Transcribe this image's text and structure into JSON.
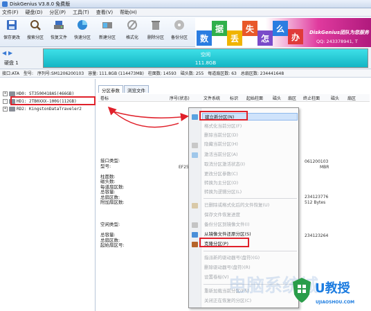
{
  "window": {
    "title": "DiskGenius V3.8.0 免费版"
  },
  "menubar": [
    "文件(F)",
    "硬盘(D)",
    "分区(P)",
    "工具(T)",
    "查看(V)",
    "帮助(H)"
  ],
  "toolbar": [
    {
      "label": "保存更改",
      "icon": "save-icon"
    },
    {
      "label": "搜索分区",
      "icon": "search-icon"
    },
    {
      "label": "恢复文件",
      "icon": "restore-icon"
    },
    {
      "label": "快速分区",
      "icon": "quick-partition-icon"
    },
    {
      "label": "新建分区",
      "icon": "new-partition-icon"
    },
    {
      "label": "格式化",
      "icon": "format-icon"
    },
    {
      "label": "删除分区",
      "icon": "delete-icon"
    },
    {
      "label": "备份分区",
      "icon": "backup-icon"
    }
  ],
  "banner": {
    "blocks": [
      "数",
      "据",
      "丢",
      "失",
      "怎",
      "么",
      "办"
    ],
    "brand": "DiskGenius团队为您服务",
    "qq": "QQ: 243378941, T"
  },
  "diskbar": {
    "disk_label": "硬盘 1",
    "partition_name": "空闲",
    "partition_size": "111.8GB"
  },
  "infobar": [
    "接口:ATA",
    "型号:",
    "序列号:SM1206200103",
    "容量: 111.8GB (114473MB)",
    "柱面数: 14593",
    "磁头数: 255",
    "每道扇区数: 63",
    "总扇区数: 234441648"
  ],
  "tree": [
    {
      "label": "HD0: ST3500418AS(466GB)",
      "expanded": "+"
    },
    {
      "label": "HD1: 2TB0XXX-100G(112GB)",
      "expanded": "-"
    },
    {
      "label": "RD2: KingstonDataTraveler2",
      "expanded": "+"
    }
  ],
  "tabs": [
    "分区参数",
    "浏览文件"
  ],
  "columns": [
    "卷标",
    "序号(状态)",
    "文件系统",
    "标识",
    "起始柱面",
    "磁头",
    "扇区",
    "终止柱面",
    "磁头",
    "扇区"
  ],
  "props_group1": [
    "接口类型:",
    "型号:",
    "",
    "柱面数:",
    "磁头数:",
    "每道扇区数:",
    "总容量:",
    "总扇区数:",
    "附加扇区数:"
  ],
  "props_group2": [
    "空闲类型:",
    "",
    "总容量:",
    "总扇区数:",
    "起始扇区号:"
  ],
  "prop_values": {
    "model": "EF250",
    "serial": "061200103",
    "mbr": "MBR",
    "sectors": "234123776",
    "bytes": "512 Bytes",
    "free_sectors": "234123264"
  },
  "context_menu": [
    {
      "label": "建立新分区(N)",
      "state": "highlighted"
    },
    {
      "label": "格式化当前分区(F)",
      "state": "disabled"
    },
    {
      "label": "删除当前分区(D)",
      "state": "disabled"
    },
    {
      "label": "隐藏当前分区(H)",
      "state": "disabled"
    },
    {
      "label": "激活当前分区(A)",
      "state": "disabled"
    },
    {
      "label": "取消分区激活状态(I)",
      "state": "disabled"
    },
    {
      "label": "更改分区参数(C)",
      "state": "disabled"
    },
    {
      "label": "转换为主分区(O)",
      "state": "disabled"
    },
    {
      "label": "转换为逻辑分区(L)",
      "state": "disabled"
    },
    {
      "label": "已删除或格式化后的文件恢复(U)",
      "state": "disabled"
    },
    {
      "label": "保存文件恢复进度",
      "state": "disabled"
    },
    {
      "label": "备份分区到镜像文件(I)",
      "state": "disabled"
    },
    {
      "label": "从镜像文件还原分区(S)",
      "state": "enabled"
    },
    {
      "label": "克隆分区(P)",
      "state": "enabled"
    },
    {
      "label": "指派新的驱动器号(盘符)(G)",
      "state": "disabled"
    },
    {
      "label": "删除驱动器号(盘符)(R)",
      "state": "disabled"
    },
    {
      "label": "设置卷标(V)",
      "state": "disabled"
    },
    {
      "label": "重新加载当前分区(F5)",
      "state": "disabled"
    },
    {
      "label": "关闭正在恢复的分区(C)",
      "state": "disabled"
    }
  ],
  "watermark": {
    "letter": "U教授",
    "site": "UJIAOSHOU.COM",
    "faint": "电脑系统城"
  },
  "colors": {
    "accent": "#e0202a",
    "partition": "#1fc6d2",
    "banner": "#d3268f",
    "watermark": "#1c7ce0"
  }
}
